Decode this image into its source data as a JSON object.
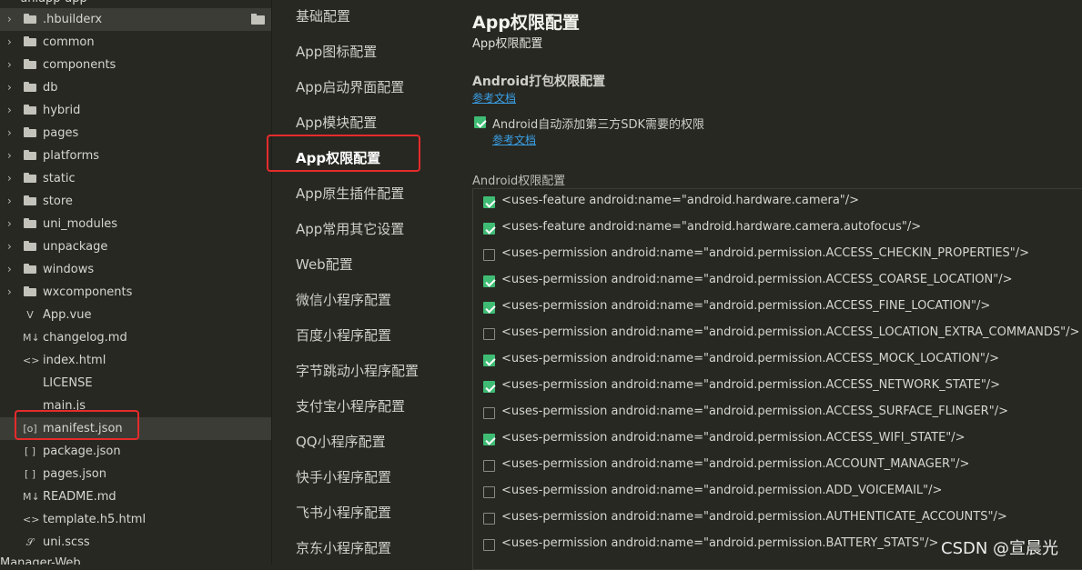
{
  "explorer": {
    "top_partial_label": "uniapp-app",
    "items": [
      {
        "label": ".hbuilderx",
        "type": "folder"
      },
      {
        "label": "common",
        "type": "folder"
      },
      {
        "label": "components",
        "type": "folder"
      },
      {
        "label": "db",
        "type": "folder"
      },
      {
        "label": "hybrid",
        "type": "folder"
      },
      {
        "label": "pages",
        "type": "folder"
      },
      {
        "label": "platforms",
        "type": "folder"
      },
      {
        "label": "static",
        "type": "folder"
      },
      {
        "label": "store",
        "type": "folder"
      },
      {
        "label": "uni_modules",
        "type": "folder"
      },
      {
        "label": "unpackage",
        "type": "folder"
      },
      {
        "label": "windows",
        "type": "folder"
      },
      {
        "label": "wxcomponents",
        "type": "folder"
      },
      {
        "label": "App.vue",
        "type": "vue",
        "icon": "V"
      },
      {
        "label": "changelog.md",
        "type": "md",
        "icon": "M↓"
      },
      {
        "label": "index.html",
        "type": "html",
        "icon": "<>"
      },
      {
        "label": "LICENSE",
        "type": "file",
        "icon": ""
      },
      {
        "label": "main.js",
        "type": "js",
        "icon": ""
      },
      {
        "label": "manifest.json",
        "type": "json",
        "icon": "[o]"
      },
      {
        "label": "package.json",
        "type": "json",
        "icon": "[ ]"
      },
      {
        "label": "pages.json",
        "type": "json",
        "icon": "[ ]"
      },
      {
        "label": "README.md",
        "type": "md",
        "icon": "M↓"
      },
      {
        "label": "template.h5.html",
        "type": "html",
        "icon": "<>"
      },
      {
        "label": "uni.scss",
        "type": "scss",
        "icon": "𝒮"
      }
    ],
    "bottom_partial_label": "Manager-Web"
  },
  "settings_nav": {
    "items": [
      "基础配置",
      "App图标配置",
      "App启动界面配置",
      "App模块配置",
      "App权限配置",
      "App原生插件配置",
      "App常用其它设置",
      "Web配置",
      "微信小程序配置",
      "百度小程序配置",
      "字节跳动小程序配置",
      "支付宝小程序配置",
      "QQ小程序配置",
      "快手小程序配置",
      "飞书小程序配置",
      "京东小程序配置"
    ],
    "active_index": 4
  },
  "main": {
    "title": "App权限配置",
    "subtitle": "App权限配置",
    "section_title": "Android打包权限配置",
    "doc_link": "参考文档",
    "auto_add_label": "Android自动添加第三方SDK需要的权限",
    "auto_add_checked": true,
    "auto_add_doc_link": "参考文档",
    "perm_section_label": "Android权限配置",
    "permissions": [
      {
        "text": "<uses-feature android:name=\"android.hardware.camera\"/>",
        "checked": true
      },
      {
        "text": "<uses-feature android:name=\"android.hardware.camera.autofocus\"/>",
        "checked": true
      },
      {
        "text": "<uses-permission android:name=\"android.permission.ACCESS_CHECKIN_PROPERTIES\"/>",
        "checked": false
      },
      {
        "text": "<uses-permission android:name=\"android.permission.ACCESS_COARSE_LOCATION\"/>",
        "checked": true
      },
      {
        "text": "<uses-permission android:name=\"android.permission.ACCESS_FINE_LOCATION\"/>",
        "checked": true
      },
      {
        "text": "<uses-permission android:name=\"android.permission.ACCESS_LOCATION_EXTRA_COMMANDS\"/>",
        "checked": false
      },
      {
        "text": "<uses-permission android:name=\"android.permission.ACCESS_MOCK_LOCATION\"/>",
        "checked": true
      },
      {
        "text": "<uses-permission android:name=\"android.permission.ACCESS_NETWORK_STATE\"/>",
        "checked": true
      },
      {
        "text": "<uses-permission android:name=\"android.permission.ACCESS_SURFACE_FLINGER\"/>",
        "checked": false
      },
      {
        "text": "<uses-permission android:name=\"android.permission.ACCESS_WIFI_STATE\"/>",
        "checked": true
      },
      {
        "text": "<uses-permission android:name=\"android.permission.ACCOUNT_MANAGER\"/>",
        "checked": false
      },
      {
        "text": "<uses-permission android:name=\"android.permission.ADD_VOICEMAIL\"/>",
        "checked": false
      },
      {
        "text": "<uses-permission android:name=\"android.permission.AUTHENTICATE_ACCOUNTS\"/>",
        "checked": false
      },
      {
        "text": "<uses-permission android:name=\"android.permission.BATTERY_STATS\"/>",
        "checked": false
      }
    ]
  },
  "watermark": "CSDN @宣晨光",
  "colors": {
    "background": "#272822",
    "highlight_box": "#e52b2b",
    "checkbox_checked": "#3fbc74",
    "link": "#3a9fe5"
  }
}
